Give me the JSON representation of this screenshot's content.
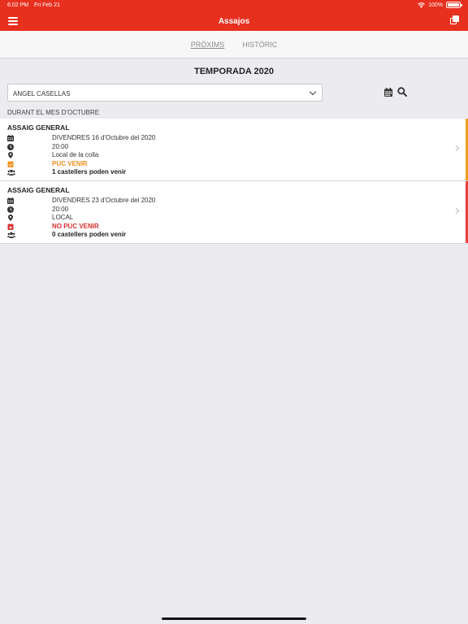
{
  "status_bar": {
    "time": "6:02 PM",
    "date": "Fri Feb 21",
    "battery": "100%"
  },
  "header": {
    "title": "Assajos"
  },
  "tabs": [
    {
      "label": "PRÒXIMS",
      "active": true
    },
    {
      "label": "HISTÒRIC",
      "active": false
    }
  ],
  "season_title": "TEMPORADA 2020",
  "person_select": {
    "selected": "ANGEL CASELLAS"
  },
  "month_label": "DURANT EL MES D'OCTUBRE",
  "rehearsals": [
    {
      "title": "ASSAIG GENERAL",
      "date": "DIVENDRES 16 d'Octubre del 2020",
      "time": "20:00",
      "place": "Local de la colla",
      "status": "PUC VENIR",
      "status_color": "#f0901e",
      "attendance": "1 castellers poden venir",
      "accent_color": "#f0a020"
    },
    {
      "title": "ASSAIG GENERAL",
      "date": "DIVENDRES 23 d'Octubre del 2020",
      "time": "20:00",
      "place": "LOCAL",
      "status": "NO PUC VENIR",
      "status_color": "#d9302c",
      "attendance": "0 castellers poden venir",
      "accent_color": "#e8403a"
    }
  ],
  "colors": {
    "brand": "#e8301f",
    "background": "#ececf0"
  },
  "icons": [
    "wifi-icon",
    "battery-icon",
    "menu-icon",
    "copy-icon",
    "calendar-icon",
    "search-icon",
    "clock-icon",
    "map-marker-icon",
    "calendar-check-icon",
    "calendar-times-icon",
    "users-icon",
    "chevron-right-icon"
  ]
}
